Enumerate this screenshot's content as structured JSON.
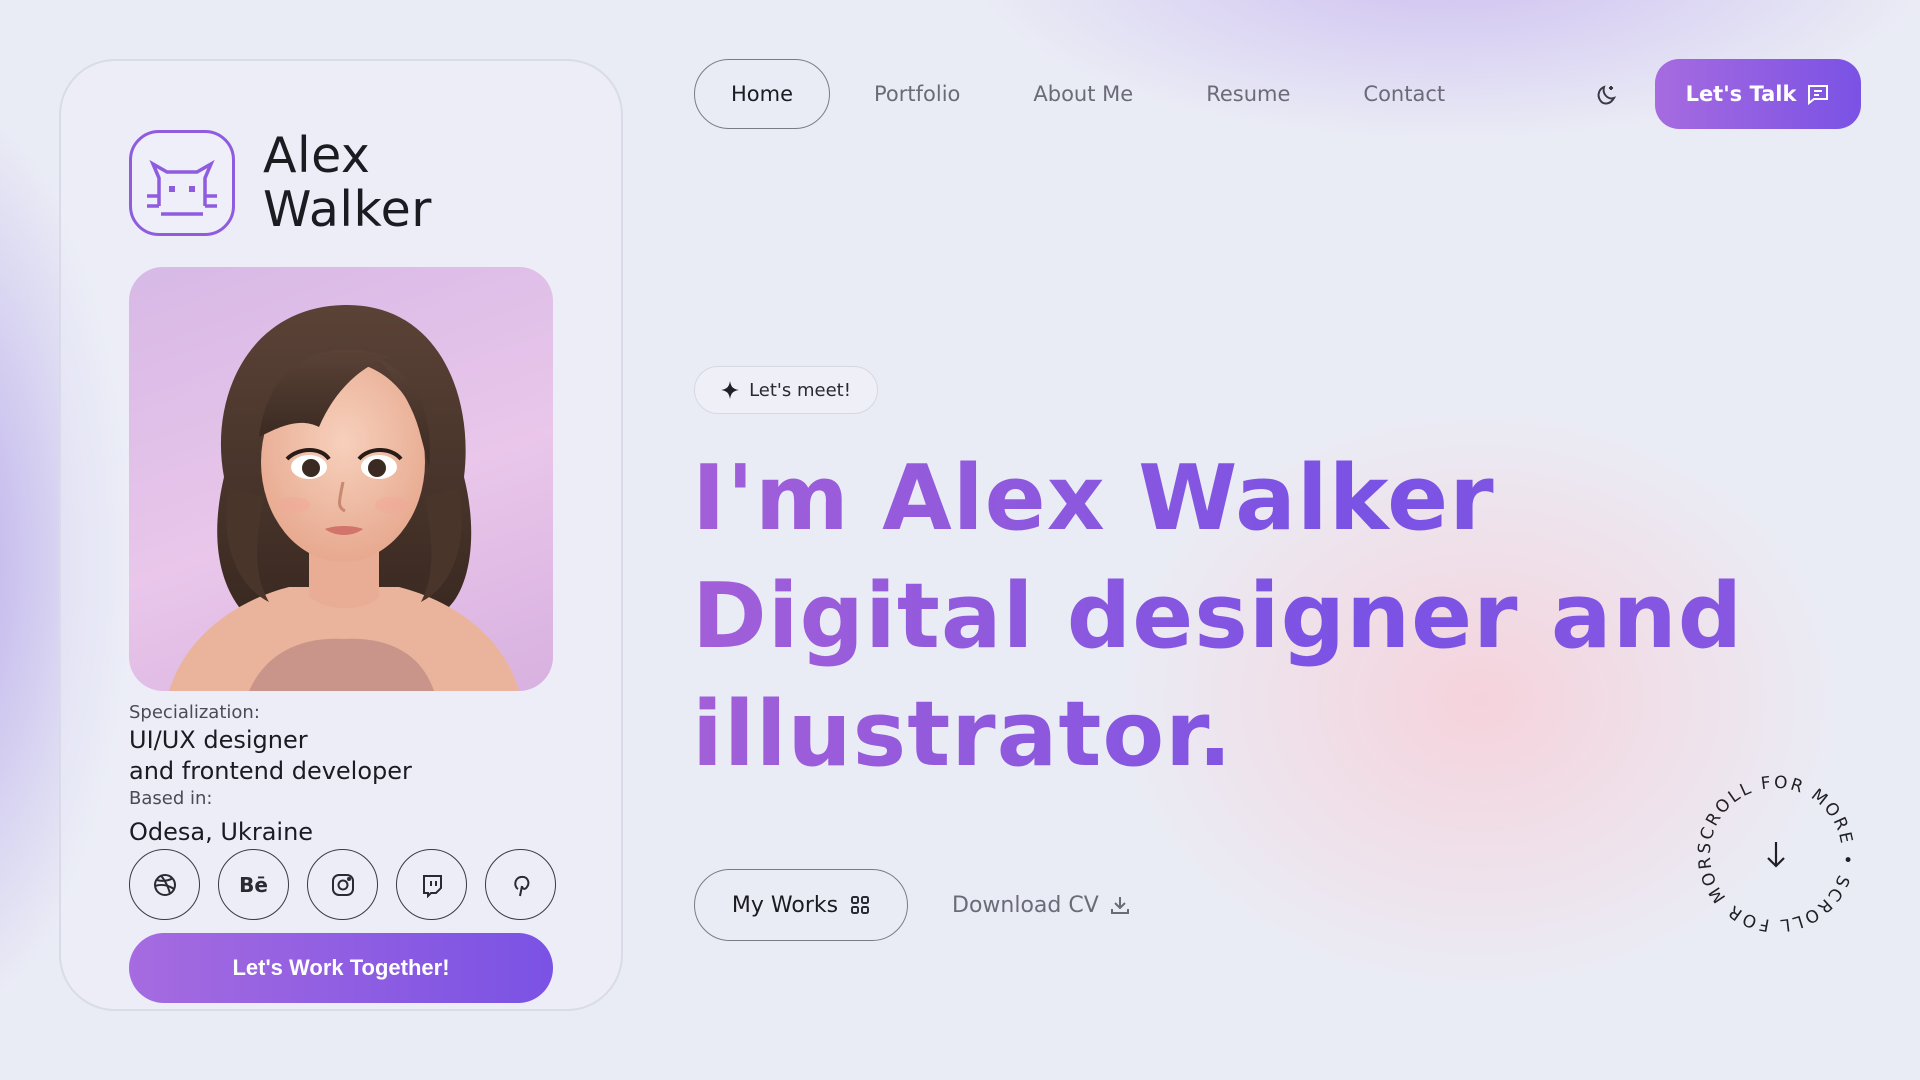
{
  "profile": {
    "first_name": "Alex",
    "last_name": "Walker",
    "specialization_label": "Specialization:",
    "specialization_line1": "UI/UX designer",
    "specialization_line2": "and frontend developer",
    "based_label": "Based in:",
    "based_value": "Odesa, Ukraine",
    "socials": [
      "dribbble-icon",
      "behance-icon",
      "instagram-icon",
      "twitch-icon",
      "pinterest-icon"
    ],
    "behance_text": "Bē",
    "cta_label": "Let's Work Together!"
  },
  "nav": {
    "items": [
      "Home",
      "Portfolio",
      "About Me",
      "Resume",
      "Contact"
    ],
    "active": "Home",
    "talk_label": "Let's Talk"
  },
  "hero": {
    "badge": "Let's meet!",
    "line1": "I'm Alex Walker",
    "line2": "Digital designer and",
    "line3": "illustrator.",
    "works_label": "My Works",
    "cv_label": "Download CV",
    "scroll_text": "SCROLL FOR MORE • SCROLL FOR MORE • "
  },
  "colors": {
    "accent_start": "#a66be0",
    "accent_end": "#7a52e4",
    "background": "#eaecf5"
  }
}
